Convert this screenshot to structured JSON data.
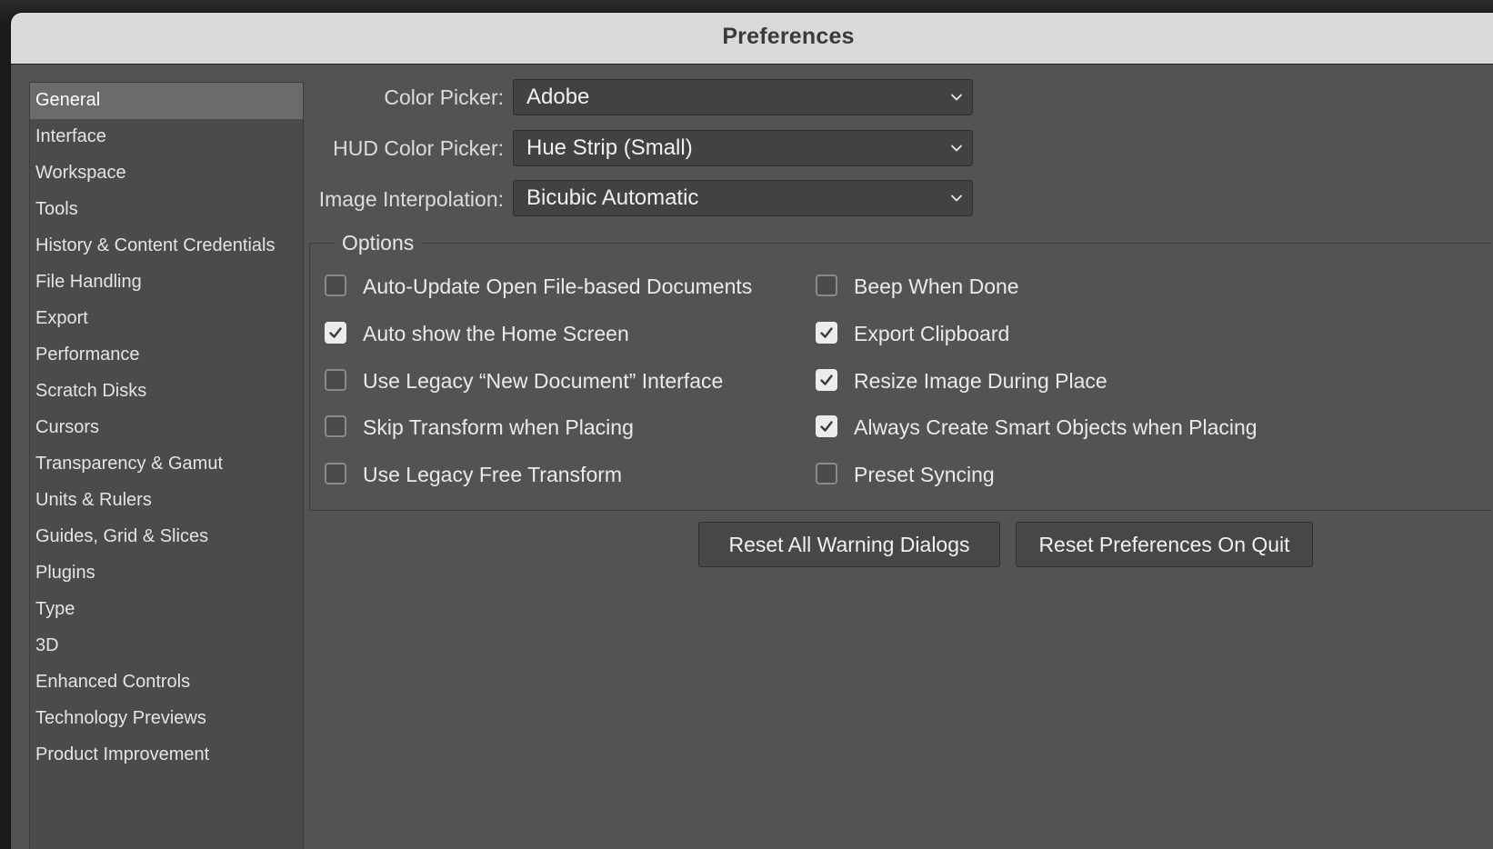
{
  "window": {
    "title": "Preferences"
  },
  "sidebar": {
    "items": [
      {
        "label": "General",
        "selected": true
      },
      {
        "label": "Interface"
      },
      {
        "label": "Workspace"
      },
      {
        "label": "Tools"
      },
      {
        "label": "History & Content Credentials"
      },
      {
        "label": "File Handling"
      },
      {
        "label": "Export"
      },
      {
        "label": "Performance"
      },
      {
        "label": "Scratch Disks"
      },
      {
        "label": "Cursors"
      },
      {
        "label": "Transparency & Gamut"
      },
      {
        "label": "Units & Rulers"
      },
      {
        "label": "Guides, Grid & Slices"
      },
      {
        "label": "Plugins"
      },
      {
        "label": "Type"
      },
      {
        "label": "3D"
      },
      {
        "label": "Enhanced Controls"
      },
      {
        "label": "Technology Previews"
      },
      {
        "label": "Product Improvement"
      }
    ]
  },
  "general": {
    "color_picker": {
      "label": "Color Picker:",
      "value": "Adobe"
    },
    "hud_color_picker": {
      "label": "HUD Color Picker:",
      "value": "Hue Strip (Small)"
    },
    "image_interpolation": {
      "label": "Image Interpolation:",
      "value": "Bicubic Automatic"
    }
  },
  "options": {
    "legend": "Options",
    "left": [
      {
        "label": "Auto-Update Open File-based Documents",
        "checked": false
      },
      {
        "label": "Auto show the Home Screen",
        "checked": true
      },
      {
        "label": "Use Legacy “New Document” Interface",
        "checked": false
      },
      {
        "label": "Skip Transform when Placing",
        "checked": false
      },
      {
        "label": "Use Legacy Free Transform",
        "checked": false
      }
    ],
    "right": [
      {
        "label": "Beep When Done",
        "checked": false
      },
      {
        "label": "Export Clipboard",
        "checked": true
      },
      {
        "label": "Resize Image During Place",
        "checked": true
      },
      {
        "label": "Always Create Smart Objects when Placing",
        "checked": true
      },
      {
        "label": "Preset Syncing",
        "checked": false
      }
    ]
  },
  "buttons": {
    "reset_warnings": "Reset All Warning Dialogs",
    "reset_prefs": "Reset Preferences On Quit"
  },
  "icons": {
    "dropdown": "chevron-down-icon",
    "check": "checkmark-icon"
  },
  "colors": {
    "panel_bg": "#535353",
    "sidebar_bg": "#4b4b4b",
    "selected_bg": "#6b6b6b",
    "titlebar_bg": "#dcd9dc"
  }
}
